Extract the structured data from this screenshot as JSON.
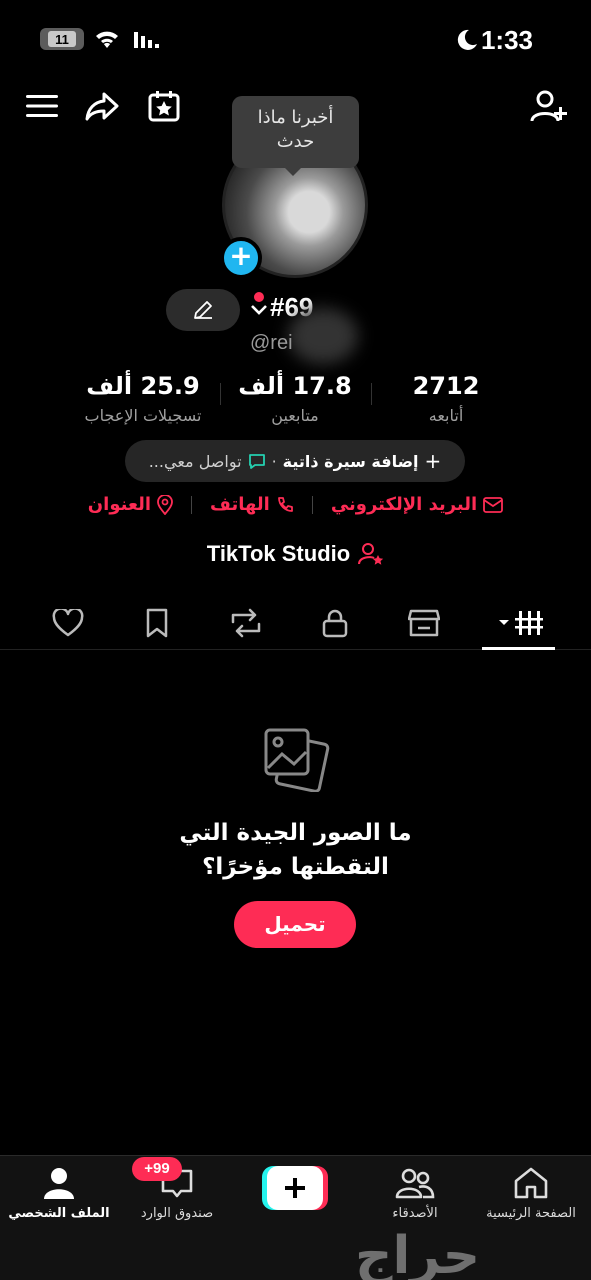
{
  "status_bar": {
    "battery": "11",
    "time": "1:33"
  },
  "tooltip": {
    "line1": "أخبرنا ماذا",
    "line2": "حدث"
  },
  "profile": {
    "name": "#69",
    "handle": "@rei"
  },
  "stats": [
    {
      "value": "2712",
      "label": "أتابعه"
    },
    {
      "value": "17.8 ألف",
      "label": "متابعين"
    },
    {
      "value": "25.9 ألف",
      "label": "تسجيلات الإعجاب"
    }
  ],
  "bio": {
    "add_label": "إضافة سيرة ذاتية",
    "separator": "·",
    "contact_label": "تواصل معي..."
  },
  "links": {
    "email": "البريد الإلكتروني",
    "phone": "الهاتف",
    "address": "العنوان"
  },
  "studio": {
    "label": "TikTok Studio"
  },
  "empty_state": {
    "line1": "ما الصور الجيدة التي",
    "line2": "التقطتها مؤخرًا؟",
    "upload_label": "تحميل"
  },
  "bottom_nav": {
    "home": "الصفحة الرئيسية",
    "friends": "الأصدقاء",
    "inbox": "صندوق الوارد",
    "inbox_badge": "+99",
    "profile": "الملف الشخصي"
  },
  "watermark": "حراج",
  "colors": {
    "accent": "#fe2c55",
    "plus_badge": "#20b6f0",
    "background": "#000000"
  }
}
